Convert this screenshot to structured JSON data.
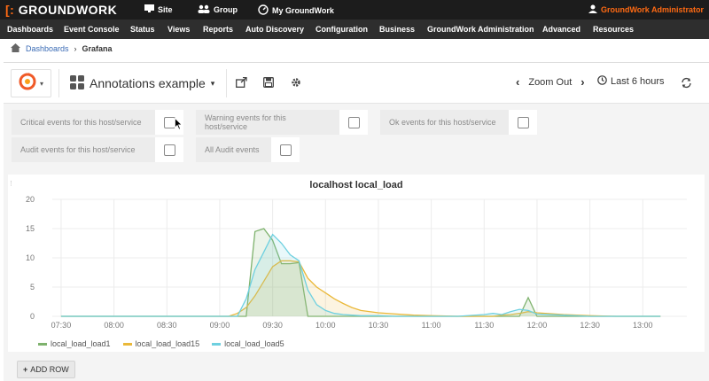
{
  "topbar": {
    "logo": "GROUNDWORK",
    "site": "Site",
    "group": "Group",
    "my_groundwork": "My GroundWork",
    "user": "GroundWork Administrator"
  },
  "nav": [
    "Dashboards",
    "Event Console",
    "Status",
    "Views",
    "Reports",
    "Auto Discovery",
    "Configuration",
    "Business",
    "GroundWork Administration",
    "Advanced",
    "Resources"
  ],
  "breadcrumb": {
    "home": "Dashboards",
    "current": "Grafana"
  },
  "toolbar": {
    "dashboard_title": "Annotations example",
    "zoom_out": "Zoom Out",
    "time_range": "Last 6 hours"
  },
  "annotations": {
    "critical": "Critical events for this host/service",
    "warning": "Warning events for this host/service",
    "ok": "Ok events for this host/service",
    "audit": "Audit events for this host/service",
    "all_audit": "All Audit events"
  },
  "add_row": "ADD ROW",
  "chart_data": {
    "type": "area",
    "title": "localhost local_load",
    "x": [
      "07:30",
      "07:45",
      "08:00",
      "08:15",
      "08:30",
      "08:45",
      "09:00",
      "09:05",
      "09:10",
      "09:15",
      "09:20",
      "09:25",
      "09:30",
      "09:35",
      "09:40",
      "09:45",
      "09:50",
      "09:55",
      "10:00",
      "10:05",
      "10:10",
      "10:15",
      "10:20",
      "10:30",
      "10:40",
      "10:50",
      "11:00",
      "11:15",
      "11:30",
      "11:35",
      "11:40",
      "11:45",
      "11:50",
      "11:55",
      "12:00",
      "12:15",
      "12:30",
      "12:45",
      "13:00",
      "13:10"
    ],
    "xticks": [
      "07:30",
      "08:00",
      "08:30",
      "09:00",
      "09:30",
      "10:00",
      "10:30",
      "11:00",
      "11:30",
      "12:00",
      "12:30",
      "13:00"
    ],
    "ylim": [
      0,
      20
    ],
    "yticks": [
      0,
      5,
      10,
      15,
      20
    ],
    "series": [
      {
        "name": "local_load_load1",
        "color": "#7eb26d",
        "values": [
          0,
          0,
          0,
          0,
          0,
          0,
          0,
          0,
          0,
          0,
          14.5,
          15,
          13,
          9,
          9,
          9.2,
          0,
          0,
          0,
          0,
          0,
          0,
          0,
          0,
          0,
          0,
          0,
          0,
          0,
          0,
          0,
          0,
          0,
          3.2,
          0,
          0,
          0,
          0,
          0,
          0
        ]
      },
      {
        "name": "local_load_load15",
        "color": "#eab839",
        "values": [
          0,
          0,
          0,
          0,
          0,
          0,
          0,
          0,
          0.5,
          1.5,
          3.5,
          6,
          8.5,
          9.5,
          9.5,
          9.3,
          6.5,
          5,
          4,
          3,
          2.2,
          1.5,
          1,
          0.6,
          0.4,
          0.2,
          0.1,
          0,
          0,
          0,
          0.2,
          0.3,
          0.5,
          0.8,
          0.6,
          0.3,
          0.1,
          0,
          0,
          0
        ]
      },
      {
        "name": "local_load_load5",
        "color": "#6ed0e0",
        "values": [
          0,
          0,
          0,
          0,
          0,
          0,
          0,
          0,
          0,
          3,
          8,
          11,
          14,
          12.5,
          10.5,
          9.5,
          4.5,
          2,
          1,
          0.5,
          0.3,
          0.2,
          0.1,
          0.1,
          0,
          0,
          0,
          0,
          0.3,
          0.5,
          0.3,
          0.8,
          1.2,
          1,
          0.4,
          0.2,
          0,
          0,
          0,
          0
        ]
      }
    ]
  }
}
